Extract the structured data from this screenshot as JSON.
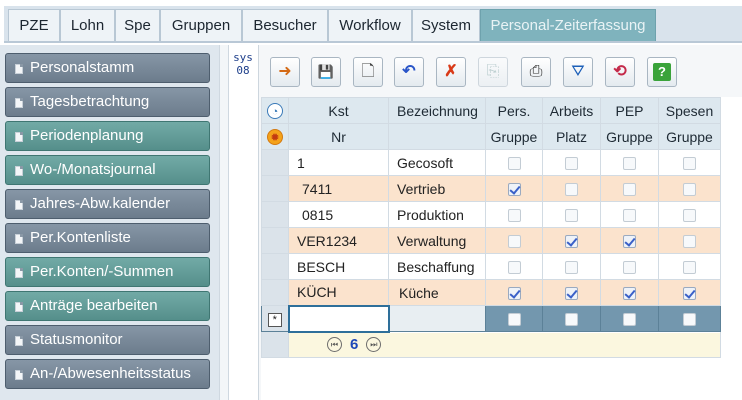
{
  "menu": {
    "items": [
      {
        "label": "PZE"
      },
      {
        "label": "Lohn"
      },
      {
        "label": "Spe"
      },
      {
        "label": "Gruppen"
      },
      {
        "label": "Besucher"
      },
      {
        "label": "Workflow"
      },
      {
        "label": "System"
      },
      {
        "label": "Personal-Zeiterfassung"
      }
    ]
  },
  "sidebar": {
    "items": [
      {
        "label": "Personalstamm"
      },
      {
        "label": "Tagesbetrachtung"
      },
      {
        "label": "Periodenplanung"
      },
      {
        "label": "Wo-/Monatsjournal"
      },
      {
        "label": "Jahres-Abw.kalender"
      },
      {
        "label": "Per.Kontenliste"
      },
      {
        "label": "Per.Konten/-Summen"
      },
      {
        "label": "Anträge bearbeiten"
      },
      {
        "label": "Statusmonitor"
      },
      {
        "label": "An-/Abwesenheitsstatus"
      }
    ]
  },
  "sys": {
    "line1": "sys",
    "line2": "08"
  },
  "toolbar": {
    "buttons": [
      {
        "icon": "arrow-import-icon",
        "glyph": "➜"
      },
      {
        "icon": "save-icon",
        "glyph": "💾"
      },
      {
        "icon": "new-document-icon",
        "glyph": "🗋"
      },
      {
        "icon": "undo-icon",
        "glyph": "↶"
      },
      {
        "icon": "delete-icon",
        "glyph": "✗"
      },
      {
        "icon": "copy-icon",
        "glyph": "⎘"
      },
      {
        "icon": "print-icon",
        "glyph": "⎙"
      },
      {
        "icon": "filter-icon",
        "glyph": "⛛"
      },
      {
        "icon": "refresh-icon",
        "glyph": "⟲"
      },
      {
        "icon": "help-icon",
        "glyph": "?"
      }
    ]
  },
  "grid": {
    "header1": {
      "kst": "Kst",
      "bez": "Bezeichnung",
      "pers": "Pers.",
      "arbeits": "Arbeits",
      "pep": "PEP",
      "spesen": "Spesen"
    },
    "header2": {
      "kst": "Nr",
      "pers": "Gruppe",
      "arbeits": "Platz",
      "pep": "Gruppe",
      "spesen": "Gruppe"
    },
    "rows": [
      {
        "kst": "1",
        "bez": "Gecosoft",
        "pers": false,
        "arbeits": false,
        "pep": false,
        "spesen": false
      },
      {
        "kst": "7411",
        "bez": "Vertrieb",
        "pers": true,
        "arbeits": false,
        "pep": false,
        "spesen": false
      },
      {
        "kst": "0815",
        "bez": "Produktion",
        "pers": false,
        "arbeits": false,
        "pep": false,
        "spesen": false
      },
      {
        "kst": "VER1234",
        "bez": "Verwaltung",
        "pers": false,
        "arbeits": true,
        "pep": true,
        "spesen": false
      },
      {
        "kst": "BESCH",
        "bez": "Beschaffung",
        "pers": false,
        "arbeits": false,
        "pep": false,
        "spesen": false
      },
      {
        "kst": "KÜCH",
        "bez": "Küche",
        "pers": true,
        "arbeits": true,
        "pep": true,
        "spesen": true
      }
    ],
    "new_row_marker": "*",
    "record_count": "6"
  },
  "colors": {
    "teal_button": "#558f8b",
    "slate_button": "#6c7c8c",
    "row_highlight": "#fbe3cd",
    "new_row": "#7397ae"
  }
}
